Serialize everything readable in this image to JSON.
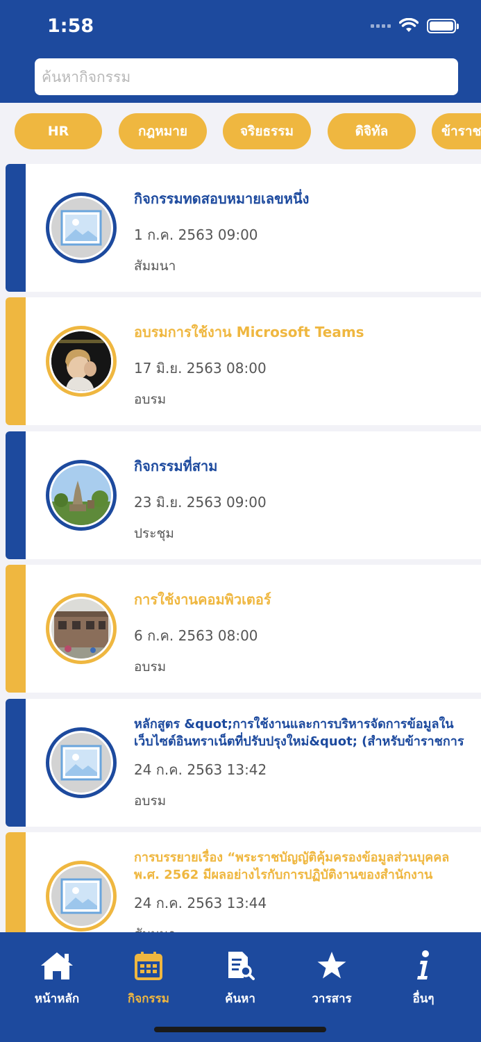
{
  "status_bar": {
    "time": "1:58"
  },
  "search": {
    "placeholder": "ค้นหากิจกรรม"
  },
  "categories": [
    "HR",
    "กฎหมาย",
    "จริยธรรม",
    "ดิจิทัล",
    "ข้าราช"
  ],
  "colors": {
    "primary": "#1d4a9e",
    "accent": "#efb740",
    "background": "#f2f2f7"
  },
  "activities": [
    {
      "title": "กิจกรรมทดสอบหมายเลขหนึ่ง",
      "date": "1 ก.ค. 2563 09:00",
      "type": "สัมมนา",
      "color": "blue",
      "image": "placeholder-image"
    },
    {
      "title": "อบรมการใช้งาน Microsoft Teams",
      "date": "17 มิ.ย. 2563 08:00",
      "type": "อบรม",
      "color": "yellow",
      "image": "person-photo"
    },
    {
      "title": "กิจกรรมที่สาม",
      "date": "23 มิ.ย. 2563 09:00",
      "type": "ประชุม",
      "color": "blue",
      "image": "temple-photo"
    },
    {
      "title": "การใช้งานคอมพิวเตอร์",
      "date": "6 ก.ค. 2563 08:00",
      "type": "อบรม",
      "color": "yellow",
      "image": "building-photo"
    },
    {
      "title": "หลักสูตร &quot;การใช้งานและการบริหารจัดการข้อมูลในเว็บไซต์อินทราเน็ตที่ปรับปรุงใหม่&quot; (สำหรับข้าราชการ",
      "date": "24 ก.ค. 2563 13:42",
      "type": "อบรม",
      "color": "blue",
      "image": "placeholder-image"
    },
    {
      "title": "การบรรยายเรื่อง “พระราชบัญญัติคุ้มครองข้อมูลส่วนบุคคล พ.ศ. 2562 มีผลอย่างไรกับการปฏิบัติงานของสำนักงาน",
      "date": "24 ก.ค. 2563 13:44",
      "type": "สัมมนา",
      "color": "yellow",
      "image": "placeholder-image"
    }
  ],
  "nav": {
    "items": [
      {
        "label": "หน้าหลัก",
        "icon": "home-icon"
      },
      {
        "label": "กิจกรรม",
        "icon": "calendar-icon",
        "active": true
      },
      {
        "label": "ค้นหา",
        "icon": "search-document-icon"
      },
      {
        "label": "วารสาร",
        "icon": "star-icon"
      },
      {
        "label": "อื่นๆ",
        "icon": "info-icon"
      }
    ]
  }
}
